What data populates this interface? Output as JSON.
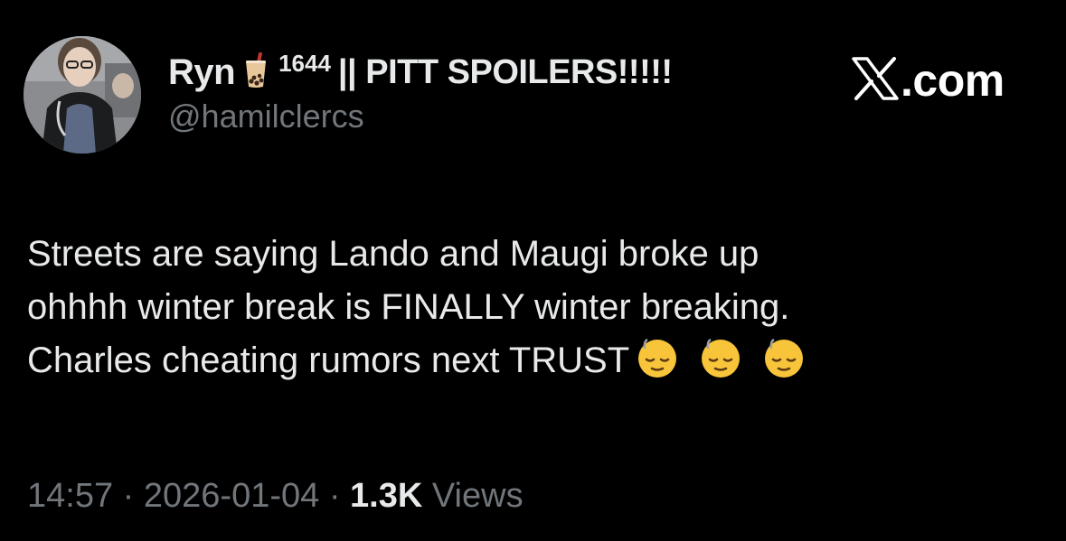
{
  "author": {
    "display_name": "Ryn",
    "name_emoji": "boba-tea-icon",
    "name_superscript": "1644",
    "name_suffix": "|| PITT SPOILERS!!!!!",
    "handle": "@hamilclercs",
    "avatar": "profile-photo"
  },
  "brand": {
    "logo_icon": "x-logo-icon",
    "text": ".com"
  },
  "tweet": {
    "lines": [
      "Streets are saying Lando and Maugi broke up",
      "ohhhh winter break is FINALLY winter breaking.",
      "Charles cheating rumors next TRUST"
    ],
    "trailing_emoji": [
      "relieved-face-sweat-icon",
      "relieved-face-sweat-icon",
      "relieved-face-sweat-icon"
    ]
  },
  "meta": {
    "time": "14:57",
    "separator": "·",
    "date": "2026-01-04",
    "views_count": "1.3K",
    "views_label": "Views"
  },
  "colors": {
    "background": "#000000",
    "primary_text": "#e7e9ea",
    "secondary_text": "#71767b"
  }
}
